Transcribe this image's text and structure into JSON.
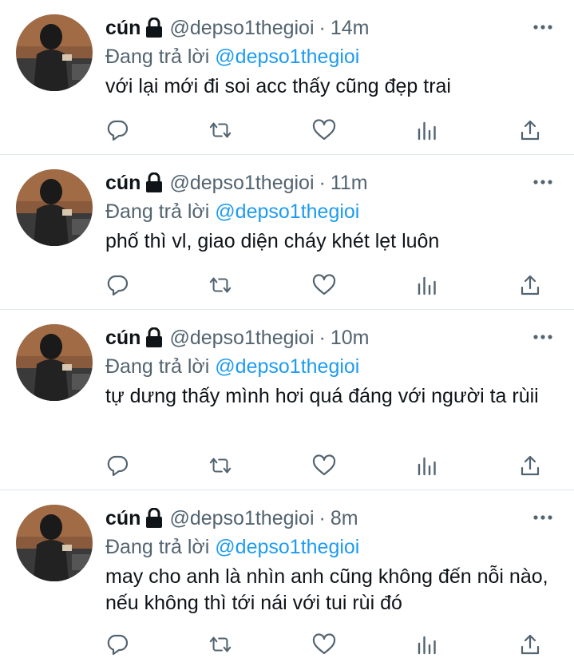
{
  "tweets": [
    {
      "name": "cún",
      "handle": "@depso1thegioi",
      "dot": "·",
      "time": "14m",
      "replying_prefix": "Đang trả lời",
      "replying_to": "@depso1thegioi",
      "text": "với lại mới đi soi acc thấy cũng đẹp trai"
    },
    {
      "name": "cún",
      "handle": "@depso1thegioi",
      "dot": "·",
      "time": "11m",
      "replying_prefix": "Đang trả lời",
      "replying_to": "@depso1thegioi",
      "text": "phố thì vl, giao diện cháy khét lẹt luôn"
    },
    {
      "name": "cún",
      "handle": "@depso1thegioi",
      "dot": "·",
      "time": "10m",
      "replying_prefix": "Đang trả lời",
      "replying_to": "@depso1thegioi",
      "text": "tự dưng thấy mình hơi quá đáng với người ta rùii"
    },
    {
      "name": "cún",
      "handle": "@depso1thegioi",
      "dot": "·",
      "time": "8m",
      "replying_prefix": "Đang trả lời",
      "replying_to": "@depso1thegioi",
      "text": "may cho anh là nhìn anh cũng không đến nỗi nào, nếu không thì tới nái với tui rùi đó"
    }
  ],
  "icons": {
    "lock": "lock-icon",
    "more": "more-options-icon",
    "reply": "reply-icon",
    "retweet": "retweet-icon",
    "like": "like-icon",
    "analytics": "analytics-icon",
    "share": "share-icon"
  },
  "colors": {
    "mention": "#1d9bf0",
    "secondary_text": "#536471",
    "icon": "#536471",
    "divider": "#e1e8ed"
  }
}
